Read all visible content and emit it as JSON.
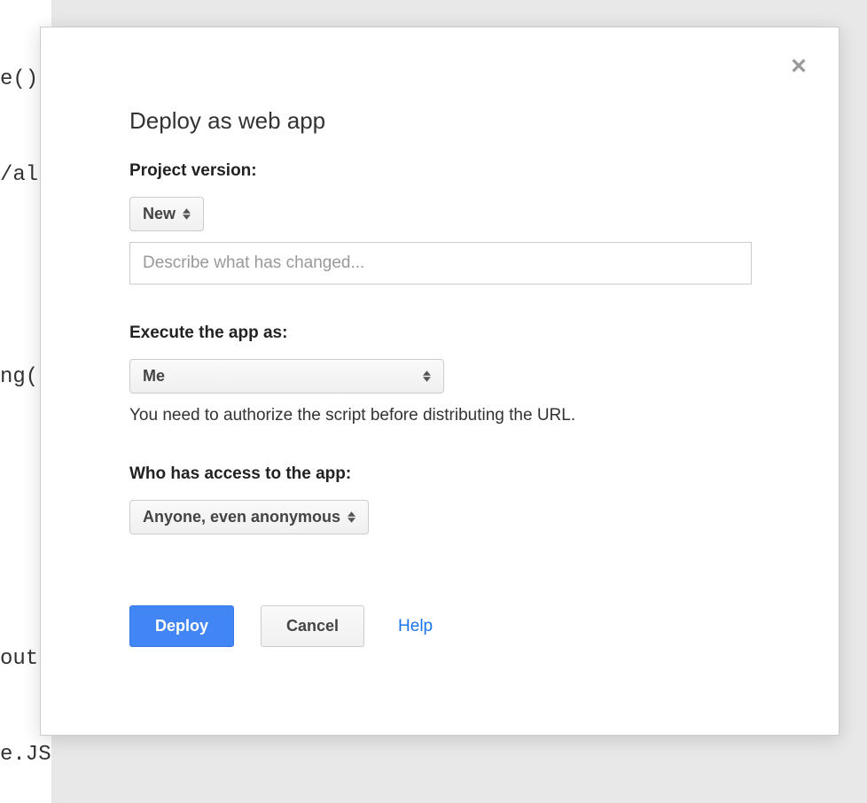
{
  "background_code": {
    "line1": "e()",
    "line2": "/alu",
    "line3": "ng(",
    "line4": "out",
    "line5": "e.JS"
  },
  "dialog": {
    "title": "Deploy as web app",
    "project_version": {
      "label": "Project version:",
      "dropdown_value": "New",
      "description_placeholder": "Describe what has changed..."
    },
    "execute_as": {
      "label": "Execute the app as:",
      "dropdown_value": "Me",
      "helper": "You need to authorize the script before distributing the URL."
    },
    "access": {
      "label": "Who has access to the app:",
      "dropdown_value": "Anyone, even anonymous"
    },
    "buttons": {
      "deploy": "Deploy",
      "cancel": "Cancel",
      "help": "Help"
    }
  }
}
